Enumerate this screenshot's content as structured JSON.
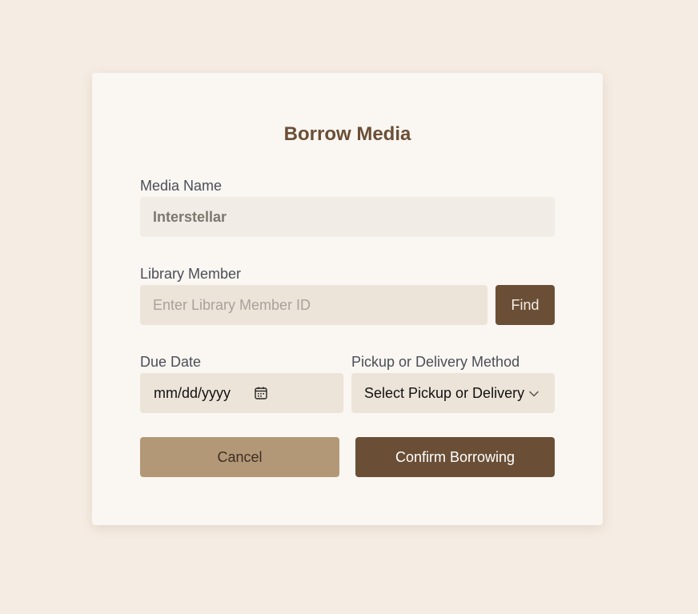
{
  "form": {
    "title": "Borrow Media",
    "media_name": {
      "label": "Media Name",
      "value": "Interstellar"
    },
    "library_member": {
      "label": "Library Member",
      "placeholder": "Enter Library Member ID",
      "find_label": "Find"
    },
    "due_date": {
      "label": "Due Date",
      "value": "mm/dd/yyyy",
      "icon": "calendar-icon"
    },
    "pickup_method": {
      "label": "Pickup or Delivery Method",
      "selected": "Select Pickup or Delivery",
      "icon": "chevron-down-icon"
    },
    "cancel_label": "Cancel",
    "confirm_label": "Confirm Borrowing"
  },
  "colors": {
    "background": "#f5ece3",
    "card": "#faf6f2",
    "accent": "#6a4f36",
    "secondary_button": "#b39878",
    "input": "#ede4d9",
    "readonly_input": "#f1ece5"
  }
}
